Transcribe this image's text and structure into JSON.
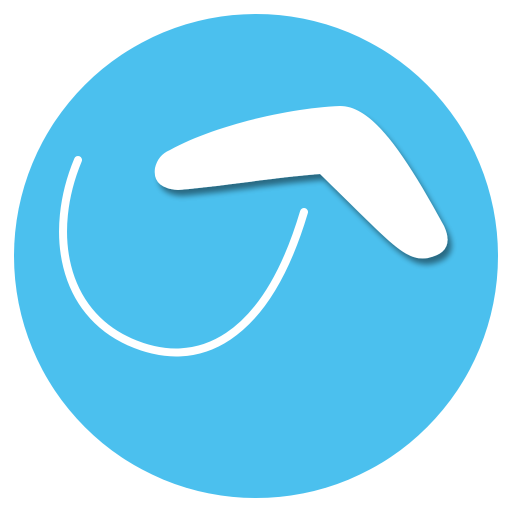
{
  "app_icon": {
    "name": "boomerang-app-icon",
    "background_color": "#4BC0EE",
    "foreground_color": "#FFFFFF",
    "shadow_color": "#2A6F8E"
  }
}
